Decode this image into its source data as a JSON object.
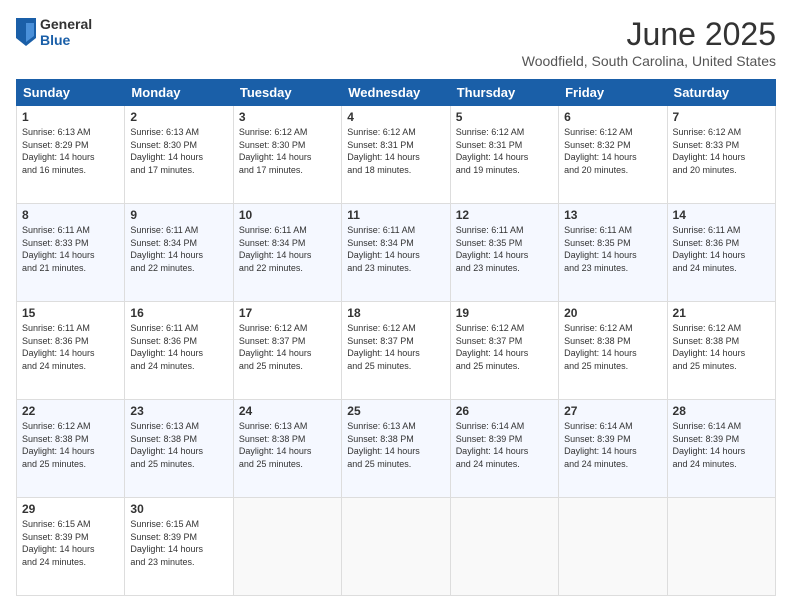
{
  "header": {
    "logo_general": "General",
    "logo_blue": "Blue",
    "month_title": "June 2025",
    "location": "Woodfield, South Carolina, United States"
  },
  "weekdays": [
    "Sunday",
    "Monday",
    "Tuesday",
    "Wednesday",
    "Thursday",
    "Friday",
    "Saturday"
  ],
  "rows": [
    [
      {
        "day": "1",
        "text": "Sunrise: 6:13 AM\nSunset: 8:29 PM\nDaylight: 14 hours\nand 16 minutes."
      },
      {
        "day": "2",
        "text": "Sunrise: 6:13 AM\nSunset: 8:30 PM\nDaylight: 14 hours\nand 17 minutes."
      },
      {
        "day": "3",
        "text": "Sunrise: 6:12 AM\nSunset: 8:30 PM\nDaylight: 14 hours\nand 17 minutes."
      },
      {
        "day": "4",
        "text": "Sunrise: 6:12 AM\nSunset: 8:31 PM\nDaylight: 14 hours\nand 18 minutes."
      },
      {
        "day": "5",
        "text": "Sunrise: 6:12 AM\nSunset: 8:31 PM\nDaylight: 14 hours\nand 19 minutes."
      },
      {
        "day": "6",
        "text": "Sunrise: 6:12 AM\nSunset: 8:32 PM\nDaylight: 14 hours\nand 20 minutes."
      },
      {
        "day": "7",
        "text": "Sunrise: 6:12 AM\nSunset: 8:33 PM\nDaylight: 14 hours\nand 20 minutes."
      }
    ],
    [
      {
        "day": "8",
        "text": "Sunrise: 6:11 AM\nSunset: 8:33 PM\nDaylight: 14 hours\nand 21 minutes."
      },
      {
        "day": "9",
        "text": "Sunrise: 6:11 AM\nSunset: 8:34 PM\nDaylight: 14 hours\nand 22 minutes."
      },
      {
        "day": "10",
        "text": "Sunrise: 6:11 AM\nSunset: 8:34 PM\nDaylight: 14 hours\nand 22 minutes."
      },
      {
        "day": "11",
        "text": "Sunrise: 6:11 AM\nSunset: 8:34 PM\nDaylight: 14 hours\nand 23 minutes."
      },
      {
        "day": "12",
        "text": "Sunrise: 6:11 AM\nSunset: 8:35 PM\nDaylight: 14 hours\nand 23 minutes."
      },
      {
        "day": "13",
        "text": "Sunrise: 6:11 AM\nSunset: 8:35 PM\nDaylight: 14 hours\nand 23 minutes."
      },
      {
        "day": "14",
        "text": "Sunrise: 6:11 AM\nSunset: 8:36 PM\nDaylight: 14 hours\nand 24 minutes."
      }
    ],
    [
      {
        "day": "15",
        "text": "Sunrise: 6:11 AM\nSunset: 8:36 PM\nDaylight: 14 hours\nand 24 minutes."
      },
      {
        "day": "16",
        "text": "Sunrise: 6:11 AM\nSunset: 8:36 PM\nDaylight: 14 hours\nand 24 minutes."
      },
      {
        "day": "17",
        "text": "Sunrise: 6:12 AM\nSunset: 8:37 PM\nDaylight: 14 hours\nand 25 minutes."
      },
      {
        "day": "18",
        "text": "Sunrise: 6:12 AM\nSunset: 8:37 PM\nDaylight: 14 hours\nand 25 minutes."
      },
      {
        "day": "19",
        "text": "Sunrise: 6:12 AM\nSunset: 8:37 PM\nDaylight: 14 hours\nand 25 minutes."
      },
      {
        "day": "20",
        "text": "Sunrise: 6:12 AM\nSunset: 8:38 PM\nDaylight: 14 hours\nand 25 minutes."
      },
      {
        "day": "21",
        "text": "Sunrise: 6:12 AM\nSunset: 8:38 PM\nDaylight: 14 hours\nand 25 minutes."
      }
    ],
    [
      {
        "day": "22",
        "text": "Sunrise: 6:12 AM\nSunset: 8:38 PM\nDaylight: 14 hours\nand 25 minutes."
      },
      {
        "day": "23",
        "text": "Sunrise: 6:13 AM\nSunset: 8:38 PM\nDaylight: 14 hours\nand 25 minutes."
      },
      {
        "day": "24",
        "text": "Sunrise: 6:13 AM\nSunset: 8:38 PM\nDaylight: 14 hours\nand 25 minutes."
      },
      {
        "day": "25",
        "text": "Sunrise: 6:13 AM\nSunset: 8:38 PM\nDaylight: 14 hours\nand 25 minutes."
      },
      {
        "day": "26",
        "text": "Sunrise: 6:14 AM\nSunset: 8:39 PM\nDaylight: 14 hours\nand 24 minutes."
      },
      {
        "day": "27",
        "text": "Sunrise: 6:14 AM\nSunset: 8:39 PM\nDaylight: 14 hours\nand 24 minutes."
      },
      {
        "day": "28",
        "text": "Sunrise: 6:14 AM\nSunset: 8:39 PM\nDaylight: 14 hours\nand 24 minutes."
      }
    ],
    [
      {
        "day": "29",
        "text": "Sunrise: 6:15 AM\nSunset: 8:39 PM\nDaylight: 14 hours\nand 24 minutes."
      },
      {
        "day": "30",
        "text": "Sunrise: 6:15 AM\nSunset: 8:39 PM\nDaylight: 14 hours\nand 23 minutes."
      },
      {
        "day": "",
        "text": ""
      },
      {
        "day": "",
        "text": ""
      },
      {
        "day": "",
        "text": ""
      },
      {
        "day": "",
        "text": ""
      },
      {
        "day": "",
        "text": ""
      }
    ]
  ]
}
